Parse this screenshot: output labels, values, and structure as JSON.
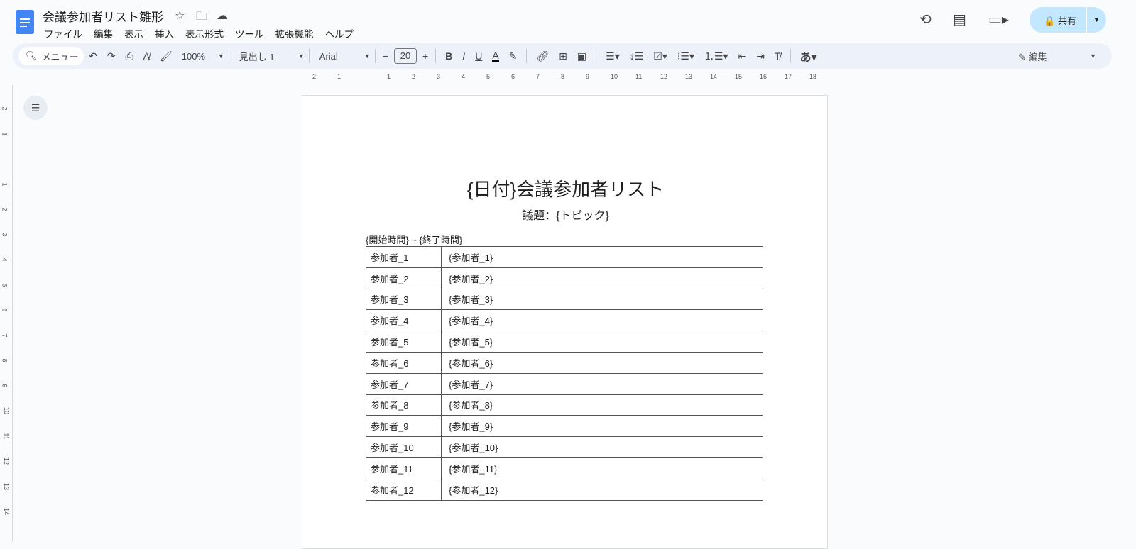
{
  "app": {
    "title": "会議参加者リスト雛形",
    "menu": [
      "ファイル",
      "編集",
      "表示",
      "挿入",
      "表示形式",
      "ツール",
      "拡張機能",
      "ヘルプ"
    ],
    "share_label": "共有"
  },
  "toolbar": {
    "search_placeholder": "メニュー",
    "zoom": "100%",
    "style": "見出し 1",
    "font": "Arial",
    "font_size": "20",
    "mode": "編集",
    "input_tool": "あ"
  },
  "ruler": {
    "h_ticks": [
      "2",
      "1",
      "",
      "1",
      "2",
      "3",
      "4",
      "5",
      "6",
      "7",
      "8",
      "9",
      "10",
      "11",
      "12",
      "13",
      "14",
      "15",
      "16",
      "17",
      "18"
    ],
    "v_ticks": [
      "2",
      "1",
      "",
      "1",
      "2",
      "3",
      "4",
      "5",
      "6",
      "7",
      "8",
      "9",
      "10",
      "11",
      "12",
      "13",
      "14"
    ]
  },
  "document": {
    "heading": "{日付}会議参加者リスト",
    "subtitle": "議題：{トピック}",
    "time_range": "{開始時間} ~ {終了時間}",
    "rows": [
      [
        "参加者_1",
        "{参加者_1}"
      ],
      [
        "参加者_2",
        "{参加者_2}"
      ],
      [
        "参加者_3",
        "{参加者_3}"
      ],
      [
        "参加者_4",
        "{参加者_4}"
      ],
      [
        "参加者_5",
        "{参加者_5}"
      ],
      [
        "参加者_6",
        "{参加者_6}"
      ],
      [
        "参加者_7",
        "{参加者_7}"
      ],
      [
        "参加者_8",
        "{参加者_8}"
      ],
      [
        "参加者_9",
        "{参加者_9}"
      ],
      [
        "参加者_10",
        "{参加者_10}"
      ],
      [
        "参加者_11",
        "{参加者_11}"
      ],
      [
        "参加者_12",
        "{参加者_12}"
      ]
    ]
  }
}
